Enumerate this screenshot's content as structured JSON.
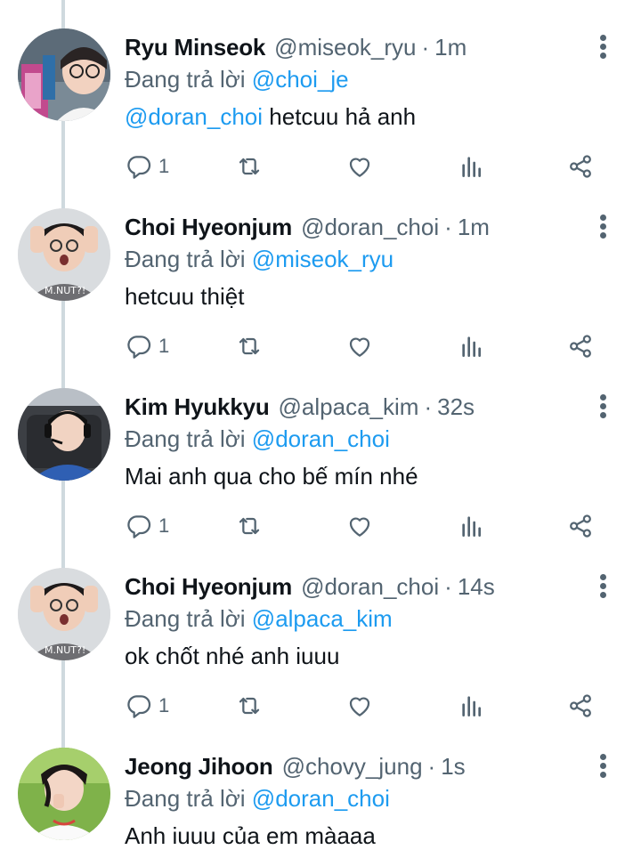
{
  "reply_prefix": "Đang trả lời",
  "colors": {
    "text_primary": "#0f1419",
    "text_secondary": "#536471",
    "mention_blue": "#1d9bf0",
    "thread_line": "#cfd9de"
  },
  "tweets": [
    {
      "name": "Ryu Minseok",
      "handle": "@miseok_ryu",
      "separator": "·",
      "time": "1m",
      "reply_to": "@choi_je",
      "mention": "@doran_choi",
      "text": " hetcuu hả anh",
      "reply_count": "1"
    },
    {
      "name": "Choi Hyeonjum",
      "handle": "@doran_choi",
      "separator": "·",
      "time": "1m",
      "reply_to": "@miseok_ryu",
      "mention": "",
      "text": "hetcuu thiệt",
      "reply_count": "1"
    },
    {
      "name": "Kim Hyukkyu",
      "handle": "@alpaca_kim",
      "separator": "·",
      "time": "32s",
      "reply_to": "@doran_choi",
      "mention": "",
      "text": "Mai anh qua cho bế mín nhé",
      "reply_count": "1"
    },
    {
      "name": "Choi Hyeonjum",
      "handle": "@doran_choi",
      "separator": "·",
      "time": "14s",
      "reply_to": "@alpaca_kim",
      "mention": "",
      "text": "ok chốt nhé anh iuuu",
      "reply_count": "1"
    },
    {
      "name": "Jeong Jihoon",
      "handle": "@chovy_jung",
      "separator": "·",
      "time": "1s",
      "reply_to": "@doran_choi",
      "mention": "",
      "text": "Anh iuuu của em màaaa",
      "reply_count": ""
    }
  ]
}
